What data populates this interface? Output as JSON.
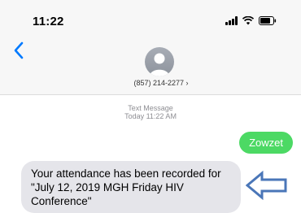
{
  "status_bar": {
    "time": "11:22",
    "icons": [
      "cellular-signal-icon",
      "wifi-icon",
      "battery-icon"
    ]
  },
  "nav": {
    "back_icon": "chevron-left-icon",
    "contact_avatar_icon": "person-silhouette-icon",
    "contact_number": "(857) 214-2277 ›"
  },
  "thread": {
    "message_kind": "Text Message",
    "timestamp": "Today 11:22 AM",
    "messages": [
      {
        "direction": "sent",
        "text": "Zowzet"
      },
      {
        "direction": "received",
        "text": "Your attendance has been recorded for \"July 12, 2019 MGH Friday HIV Conference\""
      }
    ]
  },
  "annotation": {
    "icon": "left-arrow-outline-icon"
  },
  "colors": {
    "accent_blue": "#007aff",
    "sent_bubble": "#4cd964",
    "received_bubble": "#e5e5ea",
    "annotation_arrow": "#4a76b8"
  }
}
